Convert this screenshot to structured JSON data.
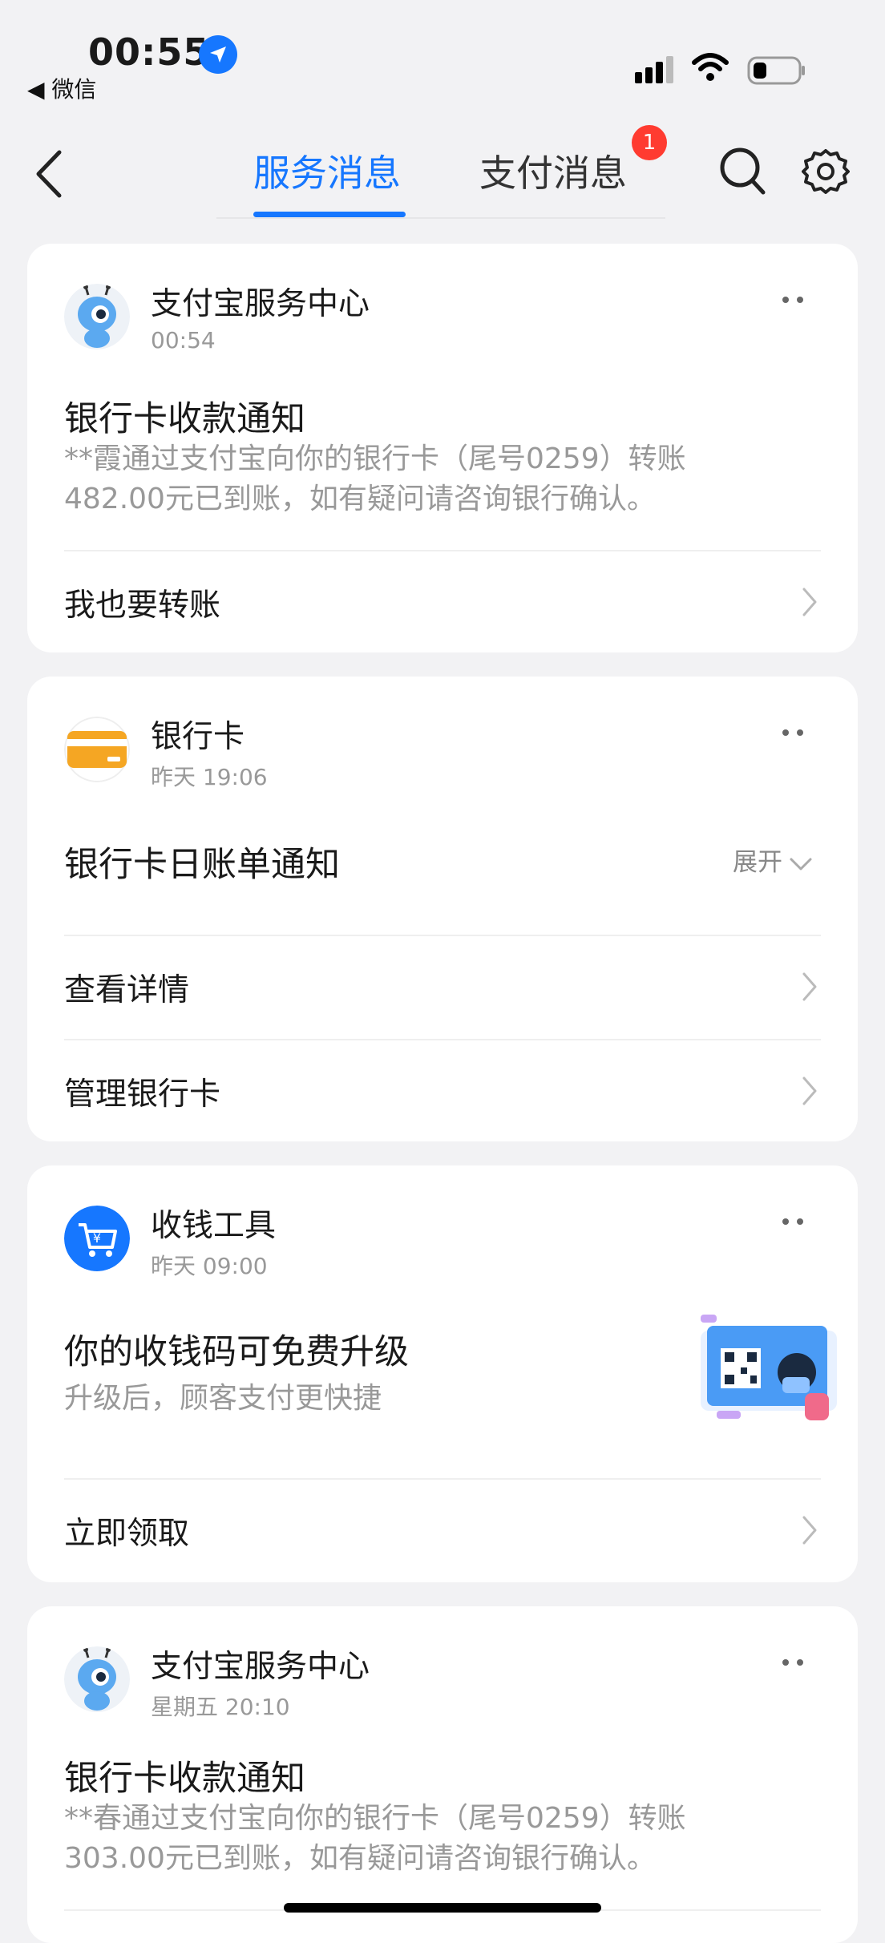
{
  "status_bar": {
    "time": "00:55",
    "back_app": "◀ 微信"
  },
  "nav": {
    "tabs": [
      {
        "label": "服务消息",
        "active": true
      },
      {
        "label": "支付消息",
        "active": false
      }
    ],
    "badge_count": "1",
    "icons": [
      "back-icon",
      "search-icon",
      "gear-icon"
    ]
  },
  "cards": [
    {
      "sender": "支付宝服务中心",
      "time": "00:54",
      "title": "银行卡收款通知",
      "body": "**霞通过支付宝向你的银行卡（尾号0259）转账482.00元已到账，如有疑问请咨询银行确认。",
      "actions": [
        "我也要转账"
      ]
    },
    {
      "sender": "银行卡",
      "time": "昨天 19:06",
      "title": "银行卡日账单通知",
      "expand_label": "展开",
      "actions": [
        "查看详情",
        "管理银行卡"
      ]
    },
    {
      "sender": "收钱工具",
      "time": "昨天 09:00",
      "title": "你的收钱码可免费升级",
      "body": "升级后，顾客支付更快捷",
      "actions": [
        "立即领取"
      ]
    },
    {
      "sender": "支付宝服务中心",
      "time": "星期五 20:10",
      "title": "银行卡收款通知",
      "body": "**春通过支付宝向你的银行卡（尾号0259）转账303.00元已到账，如有疑问请咨询银行确认。"
    }
  ],
  "colors": {
    "accent": "#1677ff",
    "badge": "#ff3b30",
    "card_icon_orange": "#f5a623",
    "background": "#f2f2f4"
  }
}
